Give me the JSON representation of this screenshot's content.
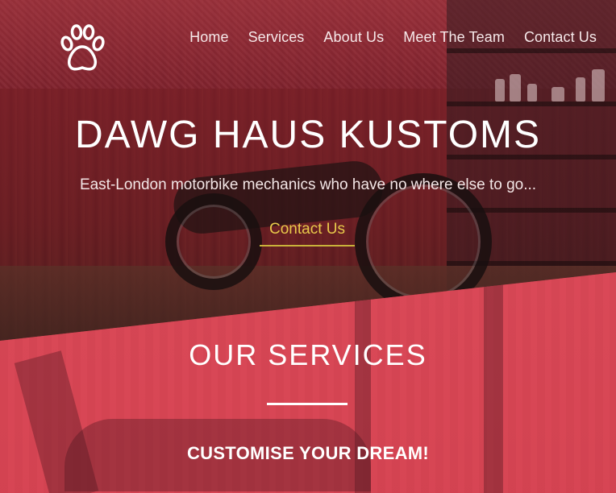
{
  "nav": {
    "logo_icon": "paw-icon",
    "items": [
      {
        "label": "Home"
      },
      {
        "label": "Services"
      },
      {
        "label": "About Us"
      },
      {
        "label": "Meet The Team"
      },
      {
        "label": "Contact Us"
      }
    ]
  },
  "hero": {
    "title": "DAWG HAUS KUSTOMS",
    "subtitle": "East-London motorbike mechanics who have no where else to go...",
    "cta": "Contact Us"
  },
  "services": {
    "title": "OUR SERVICES",
    "subtitle": "CUSTOMISE YOUR DREAM!"
  },
  "colors": {
    "hero_overlay": "#8c1e2d",
    "services_overlay": "#e6505f",
    "cta": "#e8c94a",
    "text": "#ffffff"
  }
}
